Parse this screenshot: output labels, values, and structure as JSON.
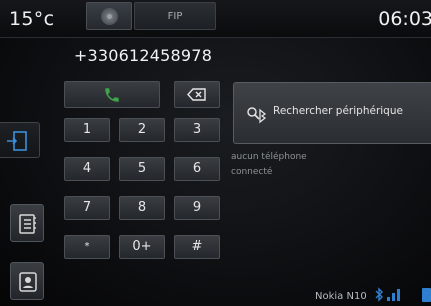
{
  "status_bar": {
    "temperature": "15°c",
    "source_tab": "FIP",
    "clock": "06:03"
  },
  "dialer": {
    "number": "+330612458978",
    "keys": [
      "1",
      "2",
      "3",
      "4",
      "5",
      "6",
      "7",
      "8",
      "9",
      "*",
      "0+",
      "#"
    ]
  },
  "search": {
    "label": "Rechercher périphérique"
  },
  "connection_status": {
    "line1": "aucun téléphone",
    "line2": "connecté"
  },
  "bottom_bar": {
    "device_name": "Nokia N10"
  },
  "icons": [
    "disc-icon",
    "call-icon",
    "backspace-icon",
    "bluetooth-search-icon",
    "phone-exit-icon",
    "phonebook-icon",
    "contacts-icon",
    "bluetooth-icon",
    "signal-icon",
    "battery-icon"
  ],
  "colors": {
    "call_green": "#3fa34a",
    "bluetooth_blue": "#2f7fd0"
  }
}
